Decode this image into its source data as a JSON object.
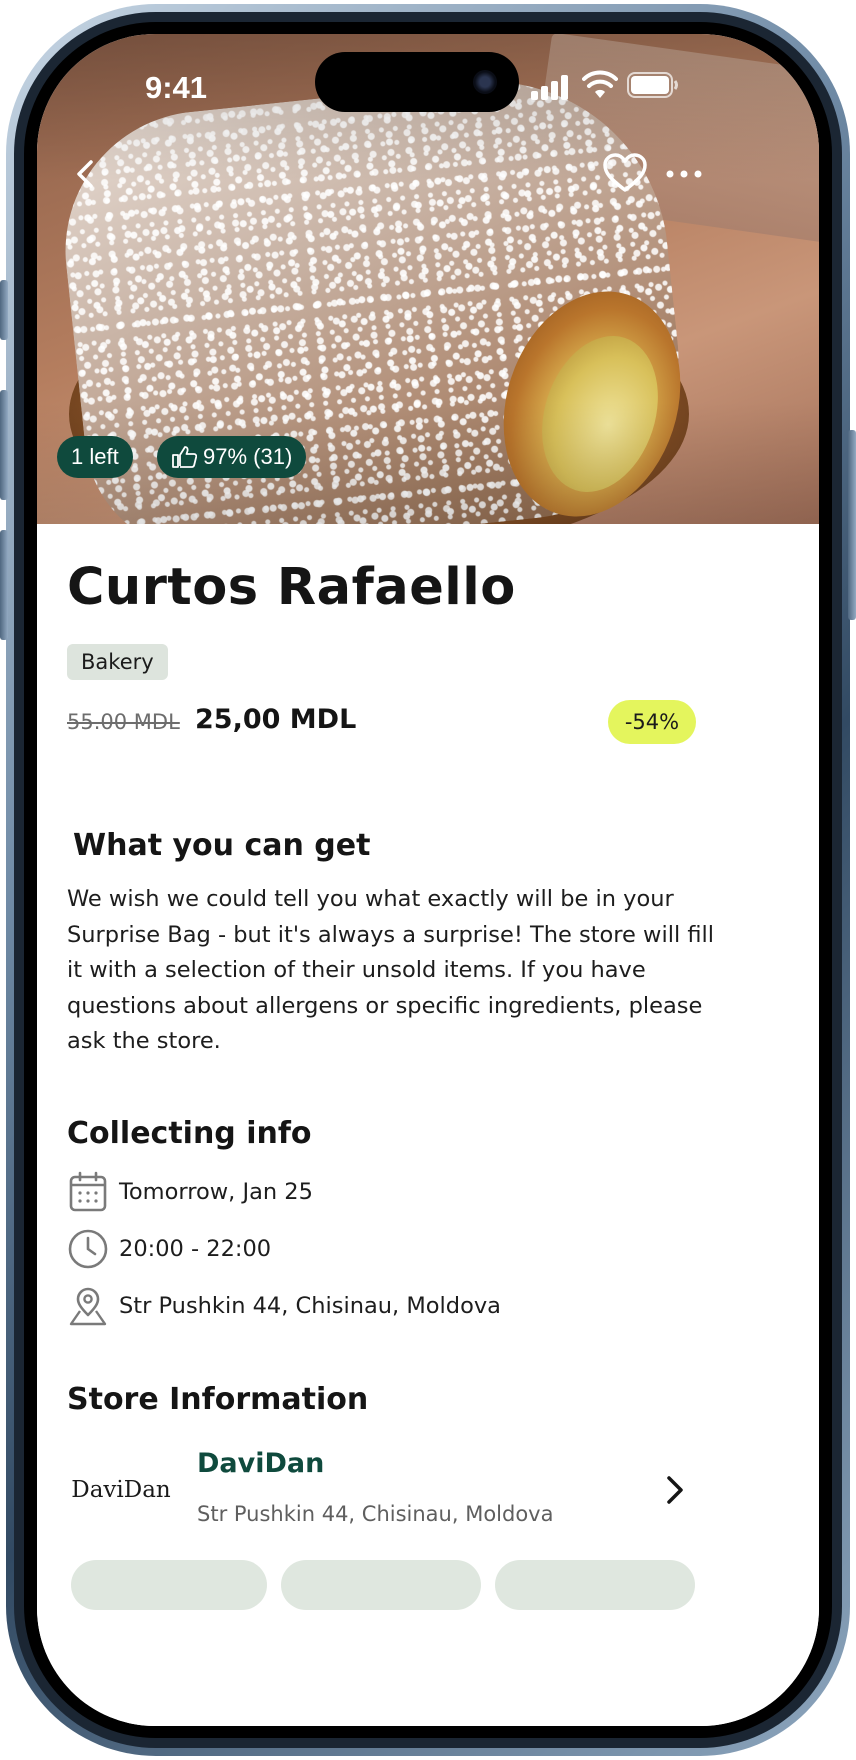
{
  "status_bar": {
    "time": "9:41"
  },
  "hero": {
    "badges": {
      "left": "1 left",
      "rating": "97% (31)"
    },
    "icons": [
      "back-icon",
      "heart-icon",
      "more-icon",
      "thumbs-up-icon"
    ]
  },
  "product": {
    "title": "Curtos Rafaello",
    "category": "Bakery",
    "old_price": "55.00 MDL",
    "new_price": "25,00 MDL",
    "discount": "-54%"
  },
  "what_you_can_get": {
    "heading": "What you can get",
    "description": "We wish we could tell you what exactly will be in your Surprise Bag - but it's always a surprise! The store will fill it with a selection of their unsold items. If you have questions about allergens or specific ingredients, please ask the store."
  },
  "collecting_info": {
    "heading": "Collecting info",
    "date": "Tomorrow, Jan 25",
    "time": "20:00 - 22:00",
    "address": "Str Pushkin 44, Chisinau, Moldova"
  },
  "store": {
    "heading": "Store Information",
    "logo_text": "DaviDan",
    "name": "DaviDan",
    "address": "Str Pushkin 44, Chisinau, Moldova"
  },
  "colors": {
    "brand_green": "#0f4a3d",
    "discount_bg": "#e4f55d",
    "tag_bg": "#dde4dd"
  }
}
